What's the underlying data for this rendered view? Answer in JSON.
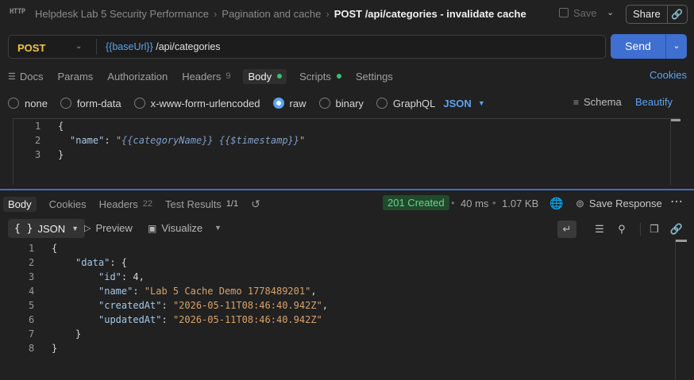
{
  "header": {
    "http_badge": "HTTP",
    "breadcrumbs": [
      "Helpdesk Lab 5 Security Performance",
      "Pagination and cache"
    ],
    "breadcrumb_sep": "›",
    "current": "POST /api/categories - invalidate cache",
    "save_label": "Save",
    "share_label": "Share"
  },
  "request": {
    "method": "POST",
    "url_var": "{{baseUrl}}",
    "url_path": " /api/categories",
    "send_label": "Send"
  },
  "req_tabs": {
    "docs": "Docs",
    "params": "Params",
    "authorization": "Authorization",
    "headers": "Headers",
    "headers_count": "9",
    "body": "Body",
    "scripts": "Scripts",
    "settings": "Settings",
    "cookies": "Cookies"
  },
  "body_types": {
    "none": "none",
    "form_data": "form-data",
    "urlencoded": "x-www-form-urlencoded",
    "raw": "raw",
    "binary": "binary",
    "graphql": "GraphQL",
    "format": "JSON",
    "schema": "Schema",
    "beautify": "Beautify"
  },
  "request_body": {
    "line_numbers": [
      "1",
      "2",
      "3"
    ],
    "open": "{",
    "key": "\"name\"",
    "colon": ": ",
    "quote_open": "\"",
    "value": "{{categoryName}} {{$timestamp}}",
    "quote_close": "\"",
    "close": "}"
  },
  "resp_tabs": {
    "body": "Body",
    "cookies": "Cookies",
    "headers": "Headers",
    "headers_count": "22",
    "test_results": "Test Results",
    "test_fraction": "1/1"
  },
  "response_meta": {
    "status": "201 Created",
    "time": "40 ms",
    "size": "1.07 KB",
    "save_response": "Save Response",
    "colors": {
      "status_bg": "#1f4a2c",
      "status_fg": "#6fd08a"
    }
  },
  "resp_toolbar": {
    "format": "JSON",
    "format_glyph": "{ }",
    "preview": "Preview",
    "visualize": "Visualize"
  },
  "response_body": {
    "line_numbers": [
      "1",
      "2",
      "3",
      "4",
      "5",
      "6",
      "7",
      "8"
    ],
    "l1": "{",
    "data_key": "\"data\"",
    "l2_rest": ": {",
    "id_key": "\"id\"",
    "id_val": ": 4,",
    "name_key": "\"name\"",
    "name_val": "\"Lab 5 Cache Demo 1778489201\"",
    "created_key": "\"createdAt\"",
    "created_val": "\"2026-05-11T08:46:40.942Z\"",
    "updated_key": "\"updatedAt\"",
    "updated_val": "\"2026-05-11T08:46:40.942Z\"",
    "l7": "}",
    "l8": "}"
  }
}
